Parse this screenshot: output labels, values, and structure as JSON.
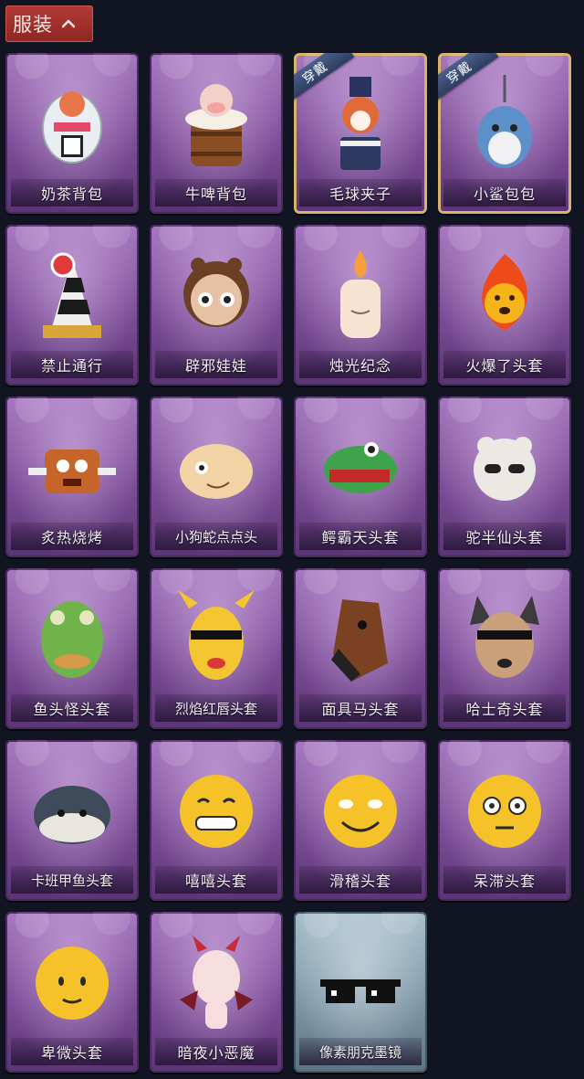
{
  "section": {
    "title": "服装"
  },
  "colors": {
    "header_red": "#a83430",
    "card_purple": "#8a5aa6",
    "card_blue": "#8aa3b3",
    "worn_gold": "#d8b46a"
  },
  "items": [
    {
      "name": "奶茶背包",
      "icon": "milk-tea-bag-icon",
      "badge": ""
    },
    {
      "name": "牛啤背包",
      "icon": "cow-beer-barrel-icon",
      "badge": ""
    },
    {
      "name": "毛球夹子",
      "icon": "red-panda-drummer-icon",
      "badge": "穿戴"
    },
    {
      "name": "小鲨包包",
      "icon": "shark-bag-icon",
      "badge": "穿戴"
    },
    {
      "name": "禁止通行",
      "icon": "traffic-cone-icon",
      "badge": ""
    },
    {
      "name": "辟邪娃娃",
      "icon": "doll-head-icon",
      "badge": ""
    },
    {
      "name": "烛光纪念",
      "icon": "candle-icon",
      "badge": ""
    },
    {
      "name": "火爆了头套",
      "icon": "fire-head-icon",
      "badge": ""
    },
    {
      "name": "炙热烧烤",
      "icon": "bbq-meat-icon",
      "badge": ""
    },
    {
      "name": "小狗蛇点点头",
      "icon": "snake-head-icon",
      "badge": ""
    },
    {
      "name": "鳄霸天头套",
      "icon": "crocodile-head-icon",
      "badge": ""
    },
    {
      "name": "驼半仙头套",
      "icon": "alpaca-head-icon",
      "badge": ""
    },
    {
      "name": "鱼头怪头套",
      "icon": "fish-head-icon",
      "badge": ""
    },
    {
      "name": "烈焰红唇头套",
      "icon": "yellow-mask-icon",
      "badge": ""
    },
    {
      "name": "面具马头套",
      "icon": "horse-head-icon",
      "badge": ""
    },
    {
      "name": "哈士奇头套",
      "icon": "husky-head-icon",
      "badge": ""
    },
    {
      "name": "卡班甲鱼头套",
      "icon": "turtle-head-icon",
      "badge": ""
    },
    {
      "name": "嘻嘻头套",
      "icon": "grin-emoji-icon",
      "badge": ""
    },
    {
      "name": "滑稽头套",
      "icon": "funny-emoji-icon",
      "badge": ""
    },
    {
      "name": "呆滞头套",
      "icon": "dazed-emoji-icon",
      "badge": ""
    },
    {
      "name": "卑微头套",
      "icon": "humble-emoji-icon",
      "badge": ""
    },
    {
      "name": "暗夜小恶魔",
      "icon": "devil-head-icon",
      "badge": ""
    },
    {
      "name": "像素朋克墨镜",
      "icon": "pixel-sunglasses-icon",
      "badge": ""
    }
  ]
}
